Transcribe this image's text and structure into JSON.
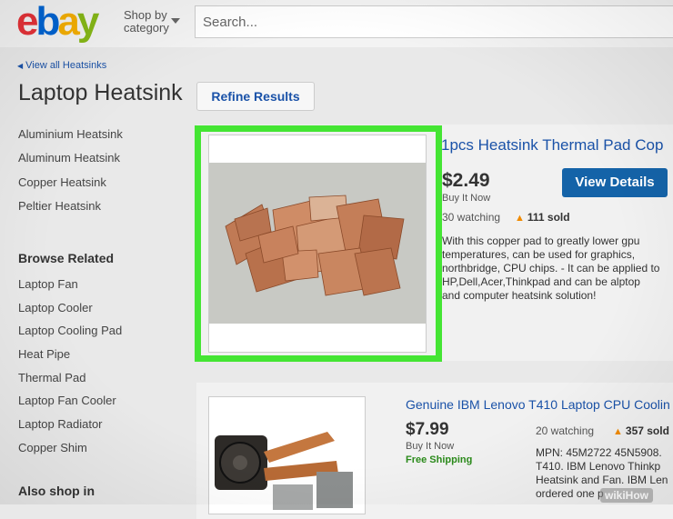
{
  "header": {
    "logo": {
      "e": "e",
      "b": "b",
      "a": "a",
      "y": "y"
    },
    "shop_by": "Shop by",
    "category": "category",
    "search_placeholder": "Search..."
  },
  "breadcrumb": "View all Heatsinks",
  "page_title": "Laptop Heatsink",
  "refine_label": "Refine Results",
  "sidebar": {
    "categories": [
      "Aluminium Heatsink",
      "Aluminum Heatsink",
      "Copper Heatsink",
      "Peltier Heatsink"
    ],
    "browse_related_heading": "Browse Related",
    "browse_related": [
      "Laptop Fan",
      "Laptop Cooler",
      "Laptop Cooling Pad",
      "Heat Pipe",
      "Thermal Pad",
      "Laptop Fan Cooler",
      "Laptop Radiator",
      "Copper Shim"
    ],
    "also_shop_heading": "Also shop in"
  },
  "listings": [
    {
      "title": "1pcs Heatsink Thermal Pad Cop",
      "price": "$2.49",
      "format": "Buy It Now",
      "watching": "30 watching",
      "sold": "111 sold",
      "description": "With this copper pad to greatly lower gpu temperatures, can be used for graphics, northbridge, CPU chips. - It can be applied to HP,Dell,Acer,Thinkpad and can be alptop and computer heatsink solution!",
      "view_details": "View Details"
    },
    {
      "title": "Genuine IBM Lenovo T410 Laptop CPU Coolin",
      "price": "$7.99",
      "format": "Buy It Now",
      "shipping": "Free Shipping",
      "watching": "20 watching",
      "sold": "357 sold",
      "description": "MPN: 45M2722 45N5908. T410. IBM Lenovo Thinkp Heatsink and Fan. IBM Len ordered one p"
    }
  ],
  "watermark": "wikiHow",
  "colors": {
    "highlight": "#44e533",
    "link": "#1a52a8",
    "button": "#1463a8"
  }
}
